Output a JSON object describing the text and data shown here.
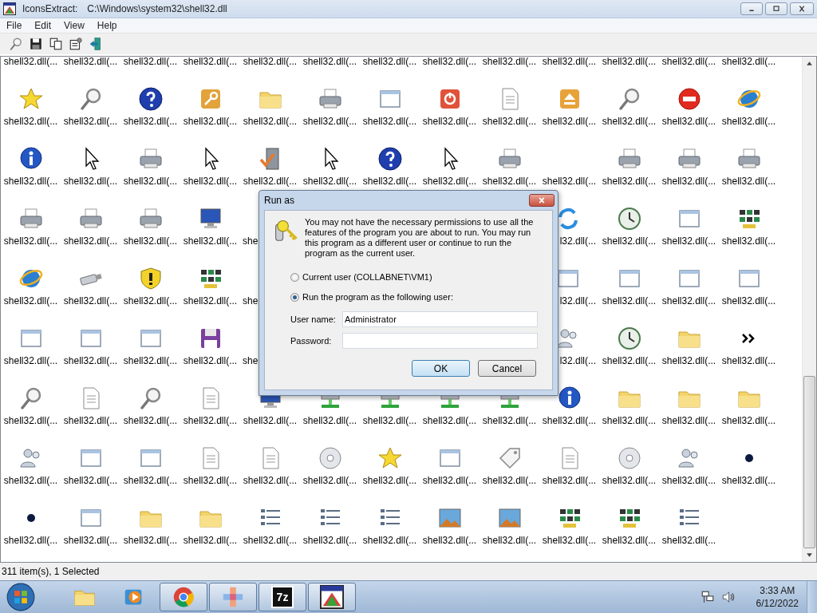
{
  "window": {
    "app_name": "IconsExtract:",
    "path": "C:\\Windows\\system32\\shell32.dll"
  },
  "menu": [
    "File",
    "Edit",
    "View",
    "Help"
  ],
  "icon_grid": {
    "rows": [
      {
        "cells": [
          {
            "kind": "full",
            "label": "shell32.dll(..."
          },
          {
            "kind": "full",
            "label": "shell32.dll(..."
          },
          {
            "kind": "full",
            "label": "shell32.dll(..."
          },
          {
            "kind": "full",
            "label": "shell32.dll(..."
          },
          {
            "kind": "full",
            "label": "shell32.dll(..."
          },
          {
            "kind": "full",
            "label": "shell32.dll(..."
          },
          {
            "kind": "full",
            "label": "shell32.dll(..."
          },
          {
            "kind": "full",
            "label": "shell32.dll(..."
          },
          {
            "kind": "full",
            "label": "shell32.dll(..."
          },
          {
            "kind": "full",
            "label": "shell32.dll(..."
          },
          {
            "kind": "full",
            "label": "shell32.dll(..."
          },
          {
            "kind": "full",
            "label": "shell32.dll(..."
          },
          {
            "kind": "full",
            "label": "shell32.dll(..."
          }
        ]
      },
      {
        "cells": [
          {
            "kind": "full",
            "label": "shell32.dll(..."
          },
          {
            "kind": "full",
            "label": "shell32.dll(..."
          },
          {
            "kind": "full",
            "label": "shell32.dll(..."
          },
          {
            "kind": "full",
            "label": "shell32.dll(..."
          },
          {
            "kind": "full",
            "label": "shell32.dll(..."
          },
          {
            "kind": "full",
            "label": "shell32.dll(..."
          },
          {
            "kind": "full",
            "label": "shell32.dll(..."
          },
          {
            "kind": "full",
            "label": "shell32.dll(..."
          },
          {
            "kind": "full",
            "label": "shell32.dll(..."
          },
          {
            "kind": "full",
            "label": "shell32.dll(..."
          },
          {
            "kind": "full",
            "label": "shell32.dll(..."
          },
          {
            "kind": "full",
            "label": "shell32.dll(..."
          },
          {
            "kind": "full",
            "label": "shell32.dll(..."
          }
        ]
      },
      {
        "cells": [
          {
            "kind": "full",
            "label": "shell32.dll(..."
          },
          {
            "kind": "full",
            "label": "shell32.dll(..."
          },
          {
            "kind": "full",
            "label": "shell32.dll(..."
          },
          {
            "kind": "full",
            "label": "shell32.dll(..."
          },
          {
            "kind": "full",
            "label": "shell32.dll(..."
          },
          {
            "kind": "full",
            "label": "shell32.dll(..."
          },
          {
            "kind": "full",
            "label": "shell32.dll(..."
          },
          {
            "kind": "full",
            "label": "shell32.dll(..."
          },
          {
            "kind": "full",
            "label": "shell32.dll(..."
          },
          {
            "kind": "full",
            "label": "shell32.dll(..."
          },
          {
            "kind": "full",
            "label": "shell32.dll(..."
          },
          {
            "kind": "full",
            "label": "shell32.dll(..."
          },
          {
            "kind": "full",
            "label": "shell32.dll(..."
          }
        ]
      },
      {
        "cells": [
          {
            "kind": "full",
            "label": "shell32.dll(..."
          },
          {
            "kind": "full",
            "label": "shell32.dll(..."
          },
          {
            "kind": "full",
            "label": "shell32.dll(..."
          },
          {
            "kind": "full",
            "label": "shell32.dll(..."
          },
          {
            "kind": "head",
            "label": "she"
          },
          {
            "kind": "hidden"
          },
          {
            "kind": "hidden"
          },
          {
            "kind": "hidden"
          },
          {
            "kind": "hidden"
          },
          {
            "kind": "tail",
            "label": "l32.dll(..."
          },
          {
            "kind": "full",
            "label": "shell32.dll(..."
          },
          {
            "kind": "full",
            "label": "shell32.dll(..."
          },
          {
            "kind": "full",
            "label": "shell32.dll(..."
          }
        ]
      },
      {
        "cells": [
          {
            "kind": "full",
            "label": "shell32.dll(..."
          },
          {
            "kind": "full",
            "label": "shell32.dll(..."
          },
          {
            "kind": "full",
            "label": "shell32.dll(..."
          },
          {
            "kind": "full",
            "label": "shell32.dll(..."
          },
          {
            "kind": "head",
            "label": "she"
          },
          {
            "kind": "hidden"
          },
          {
            "kind": "hidden"
          },
          {
            "kind": "hidden"
          },
          {
            "kind": "hidden"
          },
          {
            "kind": "tail",
            "label": "l32.dll(..."
          },
          {
            "kind": "full",
            "label": "shell32.dll(..."
          },
          {
            "kind": "full",
            "label": "shell32.dll(..."
          },
          {
            "kind": "full",
            "label": "shell32.dll(..."
          }
        ]
      },
      {
        "cells": [
          {
            "kind": "full",
            "label": "shell32.dll(..."
          },
          {
            "kind": "full",
            "label": "shell32.dll(..."
          },
          {
            "kind": "full",
            "label": "shell32.dll(..."
          },
          {
            "kind": "full",
            "label": "shell32.dll(..."
          },
          {
            "kind": "head",
            "label": "she"
          },
          {
            "kind": "hidden"
          },
          {
            "kind": "hidden"
          },
          {
            "kind": "hidden"
          },
          {
            "kind": "hidden"
          },
          {
            "kind": "tail",
            "label": "l32.dll(..."
          },
          {
            "kind": "full",
            "label": "shell32.dll(..."
          },
          {
            "kind": "full",
            "label": "shell32.dll(..."
          },
          {
            "kind": "full",
            "label": "shell32.dll(..."
          }
        ]
      },
      {
        "cells": [
          {
            "kind": "full",
            "label": "shell32.dll(..."
          },
          {
            "kind": "full",
            "label": "shell32.dll(..."
          },
          {
            "kind": "full",
            "label": "shell32.dll(..."
          },
          {
            "kind": "full",
            "label": "shell32.dll(..."
          },
          {
            "kind": "full",
            "label": "shell32.dll(..."
          },
          {
            "kind": "full",
            "label": "shell32.dll(..."
          },
          {
            "kind": "full",
            "label": "shell32.dll(..."
          },
          {
            "kind": "full",
            "label": "shell32.dll(..."
          },
          {
            "kind": "full",
            "label": "shell32.dll(..."
          },
          {
            "kind": "full",
            "label": "shell32.dll(..."
          },
          {
            "kind": "full",
            "label": "shell32.dll(..."
          },
          {
            "kind": "full",
            "label": "shell32.dll(..."
          },
          {
            "kind": "full",
            "label": "shell32.dll(..."
          }
        ]
      },
      {
        "cells": [
          {
            "kind": "full",
            "label": "shell32.dll(..."
          },
          {
            "kind": "full",
            "label": "shell32.dll(..."
          },
          {
            "kind": "full",
            "label": "shell32.dll(..."
          },
          {
            "kind": "full",
            "label": "shell32.dll(..."
          },
          {
            "kind": "full",
            "label": "shell32.dll(..."
          },
          {
            "kind": "full",
            "label": "shell32.dll(..."
          },
          {
            "kind": "full",
            "label": "shell32.dll(..."
          },
          {
            "kind": "full",
            "label": "shell32.dll(..."
          },
          {
            "kind": "full",
            "label": "shell32.dll(..."
          },
          {
            "kind": "full",
            "label": "shell32.dll(..."
          },
          {
            "kind": "full",
            "label": "shell32.dll(..."
          },
          {
            "kind": "full",
            "label": "shell32.dll(..."
          },
          {
            "kind": "full",
            "label": "shell32.dll(..."
          }
        ]
      },
      {
        "cells": [
          {
            "kind": "full",
            "label": "shell32.dll(..."
          },
          {
            "kind": "full",
            "label": "shell32.dll(..."
          },
          {
            "kind": "full",
            "label": "shell32.dll(..."
          },
          {
            "kind": "full",
            "label": "shell32.dll(..."
          },
          {
            "kind": "full",
            "label": "shell32.dll(..."
          },
          {
            "kind": "full",
            "label": "shell32.dll(..."
          },
          {
            "kind": "full",
            "label": "shell32.dll(..."
          },
          {
            "kind": "full",
            "label": "shell32.dll(..."
          },
          {
            "kind": "full",
            "label": "shell32.dll(..."
          },
          {
            "kind": "full",
            "label": "shell32.dll(..."
          },
          {
            "kind": "full",
            "label": "shell32.dll(..."
          },
          {
            "kind": "full",
            "label": "shell32.dll(..."
          }
        ]
      }
    ]
  },
  "status_bar": "311 item(s), 1 Selected",
  "dialog": {
    "title": "Run as",
    "message": "You may not have the necessary permissions to use all the features of the program you are about to run. You may run this program as a different user or continue to run the program as the current user.",
    "options": [
      {
        "label": "Current user (COLLABNET\\VM1)",
        "selected": false
      },
      {
        "label": "Run the program as the following user:",
        "selected": true
      }
    ],
    "fields": [
      {
        "label": "User name:",
        "value": "Administrator"
      },
      {
        "label": "Password:"
      }
    ],
    "buttons": [
      {
        "label": "OK",
        "default": true
      },
      {
        "label": "Cancel",
        "default": false
      }
    ]
  },
  "taskbar": {
    "buttons": [
      {
        "kind": "explorer",
        "running": false
      },
      {
        "kind": "media",
        "running": false
      },
      {
        "kind": "chrome",
        "running": true
      },
      {
        "kind": "paint",
        "running": true
      },
      {
        "kind": "archive",
        "label": "7z",
        "running": true
      },
      {
        "kind": "iconsextract",
        "running": true
      }
    ],
    "clock": {
      "time": "3:33 AM",
      "date": "6/12/2022"
    }
  }
}
